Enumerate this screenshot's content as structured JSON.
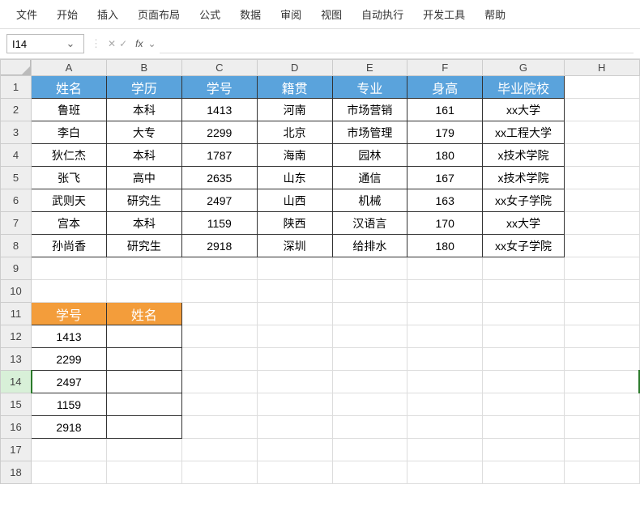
{
  "menu": [
    "文件",
    "开始",
    "插入",
    "页面布局",
    "公式",
    "数据",
    "审阅",
    "视图",
    "自动执行",
    "开发工具",
    "帮助"
  ],
  "namebox": "I14",
  "formula": "",
  "cols": [
    "A",
    "B",
    "C",
    "D",
    "E",
    "F",
    "G",
    "H"
  ],
  "rows": [
    "1",
    "2",
    "3",
    "4",
    "5",
    "6",
    "7",
    "8",
    "9",
    "10",
    "11",
    "12",
    "13",
    "14",
    "15",
    "16",
    "17",
    "18"
  ],
  "table1": {
    "headers": [
      "姓名",
      "学历",
      "学号",
      "籍贯",
      "专业",
      "身高",
      "毕业院校"
    ],
    "data": [
      [
        "鲁班",
        "本科",
        "1413",
        "河南",
        "市场营销",
        "161",
        "xx大学"
      ],
      [
        "李白",
        "大专",
        "2299",
        "北京",
        "市场管理",
        "179",
        "xx工程大学"
      ],
      [
        "狄仁杰",
        "本科",
        "1787",
        "海南",
        "园林",
        "180",
        "x技术学院"
      ],
      [
        "张飞",
        "高中",
        "2635",
        "山东",
        "通信",
        "167",
        "x技术学院"
      ],
      [
        "武则天",
        "研究生",
        "2497",
        "山西",
        "机械",
        "163",
        "xx女子学院"
      ],
      [
        "宫本",
        "本科",
        "1159",
        "陕西",
        "汉语言",
        "170",
        "xx大学"
      ],
      [
        "孙尚香",
        "研究生",
        "2918",
        "深圳",
        "给排水",
        "180",
        "xx女子学院"
      ]
    ]
  },
  "table2": {
    "headers": [
      "学号",
      "姓名"
    ],
    "data": [
      [
        "1413",
        ""
      ],
      [
        "2299",
        ""
      ],
      [
        "2497",
        ""
      ],
      [
        "1159",
        ""
      ],
      [
        "2918",
        ""
      ]
    ]
  },
  "icons": {
    "cancel": "✕",
    "confirm": "✓",
    "fx": "fx"
  }
}
